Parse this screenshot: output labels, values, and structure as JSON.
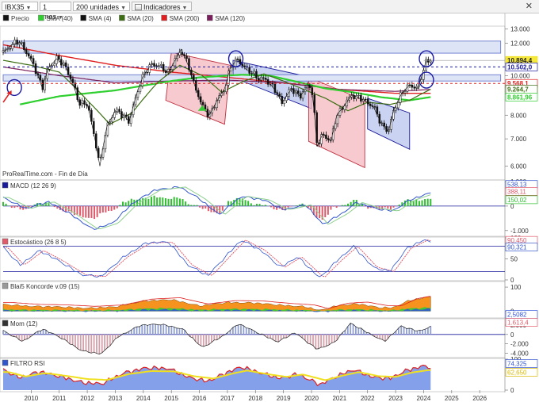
{
  "toolbar": {
    "ticker": "IBX35",
    "period": "1 mes",
    "units": "200 unidades",
    "indicators": "Indicadores",
    "close_symbol": "✕"
  },
  "colors": {
    "price": "#111111",
    "sma4": "#111111",
    "sma20": "#3d6e14",
    "sma40": "#2ecf2e",
    "sma120": "#7a1f5c",
    "sma200": "#e02020",
    "pink_box": "#f4b8bf",
    "blue_box": "#b8c4ec",
    "macd_bar": "#2fbf2f",
    "macd_bar_neg": "#e05a6a",
    "stoch_main": "#3355cc",
    "stoch_signal": "#e05a6a",
    "kon_orange": "#f5931e",
    "kon_green": "#33cc33",
    "kon_blue": "#2e4fd8",
    "mom_pos": "#8f9fd0",
    "mom_neg": "#d4a0aa",
    "rsi_fill": "#6f8fe8",
    "rsi_red": "#e02020",
    "rsi_yellow": "#f0e020"
  },
  "chart_data": [
    {
      "type": "line",
      "title": "",
      "legend": [
        "Precio",
        "SMA (40)",
        "SMA (4)",
        "SMA (20)",
        "SMA (200)",
        "SMA (120)"
      ],
      "x": [
        "2010",
        "2011",
        "2012",
        "2013",
        "2014",
        "2015",
        "2016",
        "2017",
        "2018",
        "2019",
        "2020",
        "2021",
        "2022",
        "2023",
        "2024",
        "2025",
        "2026"
      ],
      "xlim": [
        2009.0,
        2026.9
      ],
      "ylim": [
        5.6,
        13.1
      ],
      "scale": "log",
      "y_ticks": [
        "13.000",
        "12.000",
        "11.000",
        "10.000",
        "9.000",
        "8.000",
        "7.000",
        "6.000"
      ],
      "price_key": [
        [
          2009.0,
          11.4
        ],
        [
          2009.3,
          11.9
        ],
        [
          2009.6,
          12.1
        ],
        [
          2009.9,
          11.2
        ],
        [
          2010.2,
          10.2
        ],
        [
          2010.4,
          9.3
        ],
        [
          2010.6,
          10.4
        ],
        [
          2010.9,
          11.0
        ],
        [
          2011.2,
          10.6
        ],
        [
          2011.5,
          9.5
        ],
        [
          2011.7,
          8.6
        ],
        [
          2012.0,
          8.5
        ],
        [
          2012.2,
          7.4
        ],
        [
          2012.45,
          6.0
        ],
        [
          2012.7,
          7.5
        ],
        [
          2013.0,
          8.2
        ],
        [
          2013.3,
          8.0
        ],
        [
          2013.5,
          7.7
        ],
        [
          2013.8,
          9.2
        ],
        [
          2014.0,
          10.0
        ],
        [
          2014.3,
          10.7
        ],
        [
          2014.6,
          10.5
        ],
        [
          2014.9,
          10.2
        ],
        [
          2015.2,
          11.1
        ],
        [
          2015.35,
          11.6
        ],
        [
          2015.6,
          10.6
        ],
        [
          2015.8,
          9.6
        ],
        [
          2016.1,
          8.4
        ],
        [
          2016.35,
          8.0
        ],
        [
          2016.6,
          8.6
        ],
        [
          2016.9,
          9.3
        ],
        [
          2017.1,
          10.4
        ],
        [
          2017.35,
          11.0
        ],
        [
          2017.7,
          10.3
        ],
        [
          2017.9,
          10.2
        ],
        [
          2018.1,
          9.8
        ],
        [
          2018.4,
          9.8
        ],
        [
          2018.7,
          9.2
        ],
        [
          2018.95,
          8.6
        ],
        [
          2019.3,
          9.3
        ],
        [
          2019.6,
          8.9
        ],
        [
          2019.9,
          9.5
        ],
        [
          2020.0,
          9.4
        ],
        [
          2020.2,
          6.7
        ],
        [
          2020.4,
          7.2
        ],
        [
          2020.7,
          6.9
        ],
        [
          2020.9,
          8.0
        ],
        [
          2021.2,
          8.5
        ],
        [
          2021.45,
          9.0
        ],
        [
          2021.7,
          8.8
        ],
        [
          2021.9,
          8.7
        ],
        [
          2022.2,
          8.4
        ],
        [
          2022.5,
          7.6
        ],
        [
          2022.75,
          7.3
        ],
        [
          2022.95,
          8.3
        ],
        [
          2023.2,
          9.0
        ],
        [
          2023.5,
          9.5
        ],
        [
          2023.8,
          9.3
        ],
        [
          2023.95,
          10.1
        ],
        [
          2024.1,
          10.9
        ],
        [
          2024.25,
          10.9
        ]
      ],
      "sma_key": {
        "sma200": [
          [
            2009.0,
            11.9
          ],
          [
            2011.0,
            11.2
          ],
          [
            2013.0,
            10.6
          ],
          [
            2015.0,
            10.2
          ],
          [
            2017.0,
            9.9
          ],
          [
            2019.0,
            9.6
          ],
          [
            2021.0,
            9.25
          ],
          [
            2023.0,
            9.05
          ],
          [
            2024.25,
            9.05
          ]
        ],
        "sma120": [
          [
            2009.0,
            10.5
          ],
          [
            2011.0,
            10.0
          ],
          [
            2013.0,
            9.6
          ],
          [
            2015.0,
            9.7
          ],
          [
            2017.0,
            9.75
          ],
          [
            2019.0,
            9.6
          ],
          [
            2021.0,
            9.25
          ],
          [
            2023.0,
            9.15
          ],
          [
            2024.25,
            9.25
          ]
        ],
        "sma40": [
          [
            2009.6,
            8.5
          ],
          [
            2011.0,
            8.9
          ],
          [
            2013.0,
            9.2
          ],
          [
            2015.0,
            9.7
          ],
          [
            2016.0,
            9.9
          ],
          [
            2017.5,
            10.05
          ],
          [
            2018.5,
            10.0
          ],
          [
            2019.5,
            9.65
          ],
          [
            2020.5,
            9.3
          ],
          [
            2021.5,
            9.1
          ],
          [
            2022.5,
            8.85
          ],
          [
            2023.5,
            8.7
          ],
          [
            2024.25,
            8.86
          ]
        ],
        "sma20": [
          [
            2009.0,
            10.9
          ],
          [
            2010.0,
            10.6
          ],
          [
            2011.0,
            10.2
          ],
          [
            2012.0,
            8.7
          ],
          [
            2012.8,
            7.6
          ],
          [
            2013.6,
            8.1
          ],
          [
            2014.5,
            9.6
          ],
          [
            2015.3,
            10.6
          ],
          [
            2016.1,
            10.0
          ],
          [
            2016.8,
            9.1
          ],
          [
            2017.6,
            9.7
          ],
          [
            2018.3,
            10.1
          ],
          [
            2019.0,
            9.7
          ],
          [
            2019.8,
            9.2
          ],
          [
            2020.5,
            8.8
          ],
          [
            2021.3,
            8.2
          ],
          [
            2022.0,
            8.6
          ],
          [
            2022.8,
            8.5
          ],
          [
            2023.5,
            8.7
          ],
          [
            2024.25,
            9.26
          ]
        ]
      },
      "levels": [
        {
          "value": 10.894,
          "label": "10.894,4",
          "color": "#f0e020",
          "style": "solid"
        },
        {
          "value": 10.502,
          "label": "10.502,0",
          "color": "#1a1aa0",
          "style": "dashed"
        },
        {
          "value": 9.568,
          "label": "9.568,1",
          "color": "#e02020",
          "style": "dashed"
        },
        {
          "value": 9.264,
          "label": "9.264,7",
          "color": "#3d6e14",
          "style": "none"
        },
        {
          "value": 8.861,
          "label": "8.861,96",
          "color": "#2ecf2e",
          "style": "none"
        }
      ],
      "annotation": "ProRealTime.com - Fin de Día"
    },
    {
      "type": "bar",
      "title": "MACD (12 26 9)",
      "y_ticks": [
        "1.000",
        "0",
        "-1.000"
      ],
      "ylim": [
        -1200,
        1000
      ],
      "value_labels": [
        "538,13",
        "388,11",
        "150,02"
      ],
      "key": [
        [
          2009.0,
          350
        ],
        [
          2009.8,
          -100
        ],
        [
          2010.6,
          180
        ],
        [
          2011.3,
          -250
        ],
        [
          2012.2,
          -950
        ],
        [
          2012.9,
          -700
        ],
        [
          2013.6,
          100
        ],
        [
          2014.4,
          650
        ],
        [
          2015.3,
          780
        ],
        [
          2016.0,
          300
        ],
        [
          2016.7,
          -350
        ],
        [
          2017.5,
          400
        ],
        [
          2018.3,
          250
        ],
        [
          2019.0,
          -150
        ],
        [
          2019.8,
          50
        ],
        [
          2020.4,
          -750
        ],
        [
          2021.1,
          -300
        ],
        [
          2021.6,
          150
        ],
        [
          2022.3,
          -100
        ],
        [
          2022.9,
          -200
        ],
        [
          2023.5,
          250
        ],
        [
          2024.25,
          540
        ]
      ]
    },
    {
      "type": "line",
      "title": "Estocástico (26 8 5)",
      "y_ticks": [
        "100",
        "50",
        "0"
      ],
      "ylim": [
        0,
        100
      ],
      "value_labels": [
        "90,450",
        "90,321"
      ],
      "key": [
        [
          2009.0,
          78
        ],
        [
          2009.6,
          35
        ],
        [
          2010.3,
          70
        ],
        [
          2011.0,
          45
        ],
        [
          2011.8,
          12
        ],
        [
          2012.5,
          8
        ],
        [
          2013.3,
          55
        ],
        [
          2014.1,
          88
        ],
        [
          2014.9,
          90
        ],
        [
          2015.6,
          35
        ],
        [
          2016.3,
          10
        ],
        [
          2017.0,
          60
        ],
        [
          2017.5,
          95
        ],
        [
          2018.2,
          70
        ],
        [
          2018.9,
          30
        ],
        [
          2019.5,
          55
        ],
        [
          2020.3,
          5
        ],
        [
          2020.9,
          45
        ],
        [
          2021.5,
          80
        ],
        [
          2022.2,
          30
        ],
        [
          2022.8,
          20
        ],
        [
          2023.4,
          75
        ],
        [
          2024.0,
          95
        ],
        [
          2024.25,
          90
        ]
      ]
    },
    {
      "type": "area",
      "title": "Blai5 Koncorde v.09 (15)",
      "y_ticks": [
        "100",
        "0"
      ],
      "ylim": [
        -25,
        120
      ],
      "value_labels": [
        "2,5082"
      ],
      "key": [
        [
          2009.0,
          28
        ],
        [
          2010.0,
          20
        ],
        [
          2011.0,
          18
        ],
        [
          2012.0,
          12
        ],
        [
          2013.0,
          18
        ],
        [
          2014.0,
          42
        ],
        [
          2015.0,
          48
        ],
        [
          2016.0,
          22
        ],
        [
          2017.0,
          36
        ],
        [
          2018.0,
          34
        ],
        [
          2019.0,
          24
        ],
        [
          2019.8,
          18
        ],
        [
          2020.3,
          3
        ],
        [
          2021.0,
          25
        ],
        [
          2021.7,
          30
        ],
        [
          2022.4,
          15
        ],
        [
          2022.9,
          14
        ],
        [
          2023.5,
          45
        ],
        [
          2024.25,
          60
        ]
      ]
    },
    {
      "type": "area",
      "title": "Mom (12)",
      "y_ticks": [
        "2.000",
        "0",
        "-2.000",
        "-4.000"
      ],
      "ylim": [
        -4800,
        3200
      ],
      "value_labels": [
        "1.613,4"
      ],
      "key": [
        [
          2009.0,
          800
        ],
        [
          2009.7,
          -1500
        ],
        [
          2010.4,
          1200
        ],
        [
          2011.0,
          -500
        ],
        [
          2011.8,
          -3500
        ],
        [
          2012.5,
          -4200
        ],
        [
          2013.1,
          -500
        ],
        [
          2013.9,
          2000
        ],
        [
          2014.6,
          2200
        ],
        [
          2015.4,
          1200
        ],
        [
          2016.1,
          -2800
        ],
        [
          2016.8,
          -500
        ],
        [
          2017.4,
          2300
        ],
        [
          2018.0,
          600
        ],
        [
          2018.8,
          -1600
        ],
        [
          2019.4,
          400
        ],
        [
          2020.2,
          -3200
        ],
        [
          2020.8,
          -1800
        ],
        [
          2021.4,
          2400
        ],
        [
          2022.0,
          400
        ],
        [
          2022.6,
          -1500
        ],
        [
          2023.2,
          1800
        ],
        [
          2023.8,
          700
        ],
        [
          2024.25,
          1613
        ]
      ]
    },
    {
      "type": "area",
      "title": "FILTRO RSI",
      "y_ticks": [
        "100",
        "0"
      ],
      "ylim": [
        0,
        100
      ],
      "value_labels": [
        "74,325",
        "62,650"
      ],
      "key": [
        [
          2009.0,
          66
        ],
        [
          2009.6,
          40
        ],
        [
          2010.3,
          60
        ],
        [
          2011.0,
          45
        ],
        [
          2011.8,
          25
        ],
        [
          2012.5,
          20
        ],
        [
          2013.3,
          55
        ],
        [
          2014.1,
          72
        ],
        [
          2014.9,
          70
        ],
        [
          2015.6,
          42
        ],
        [
          2016.3,
          28
        ],
        [
          2017.0,
          58
        ],
        [
          2017.5,
          75
        ],
        [
          2018.2,
          55
        ],
        [
          2018.9,
          38
        ],
        [
          2019.5,
          52
        ],
        [
          2020.3,
          18
        ],
        [
          2020.9,
          45
        ],
        [
          2021.5,
          66
        ],
        [
          2022.2,
          42
        ],
        [
          2022.8,
          38
        ],
        [
          2023.4,
          64
        ],
        [
          2024.0,
          78
        ],
        [
          2024.25,
          74
        ]
      ]
    }
  ],
  "legend_main": {
    "items": [
      "Precio",
      "SMA (40)",
      "SMA (4)",
      "SMA (20)",
      "SMA (200)",
      "SMA (120)"
    ]
  },
  "annotations": {
    "source": "ProRealTime.com - Fin de Día"
  }
}
